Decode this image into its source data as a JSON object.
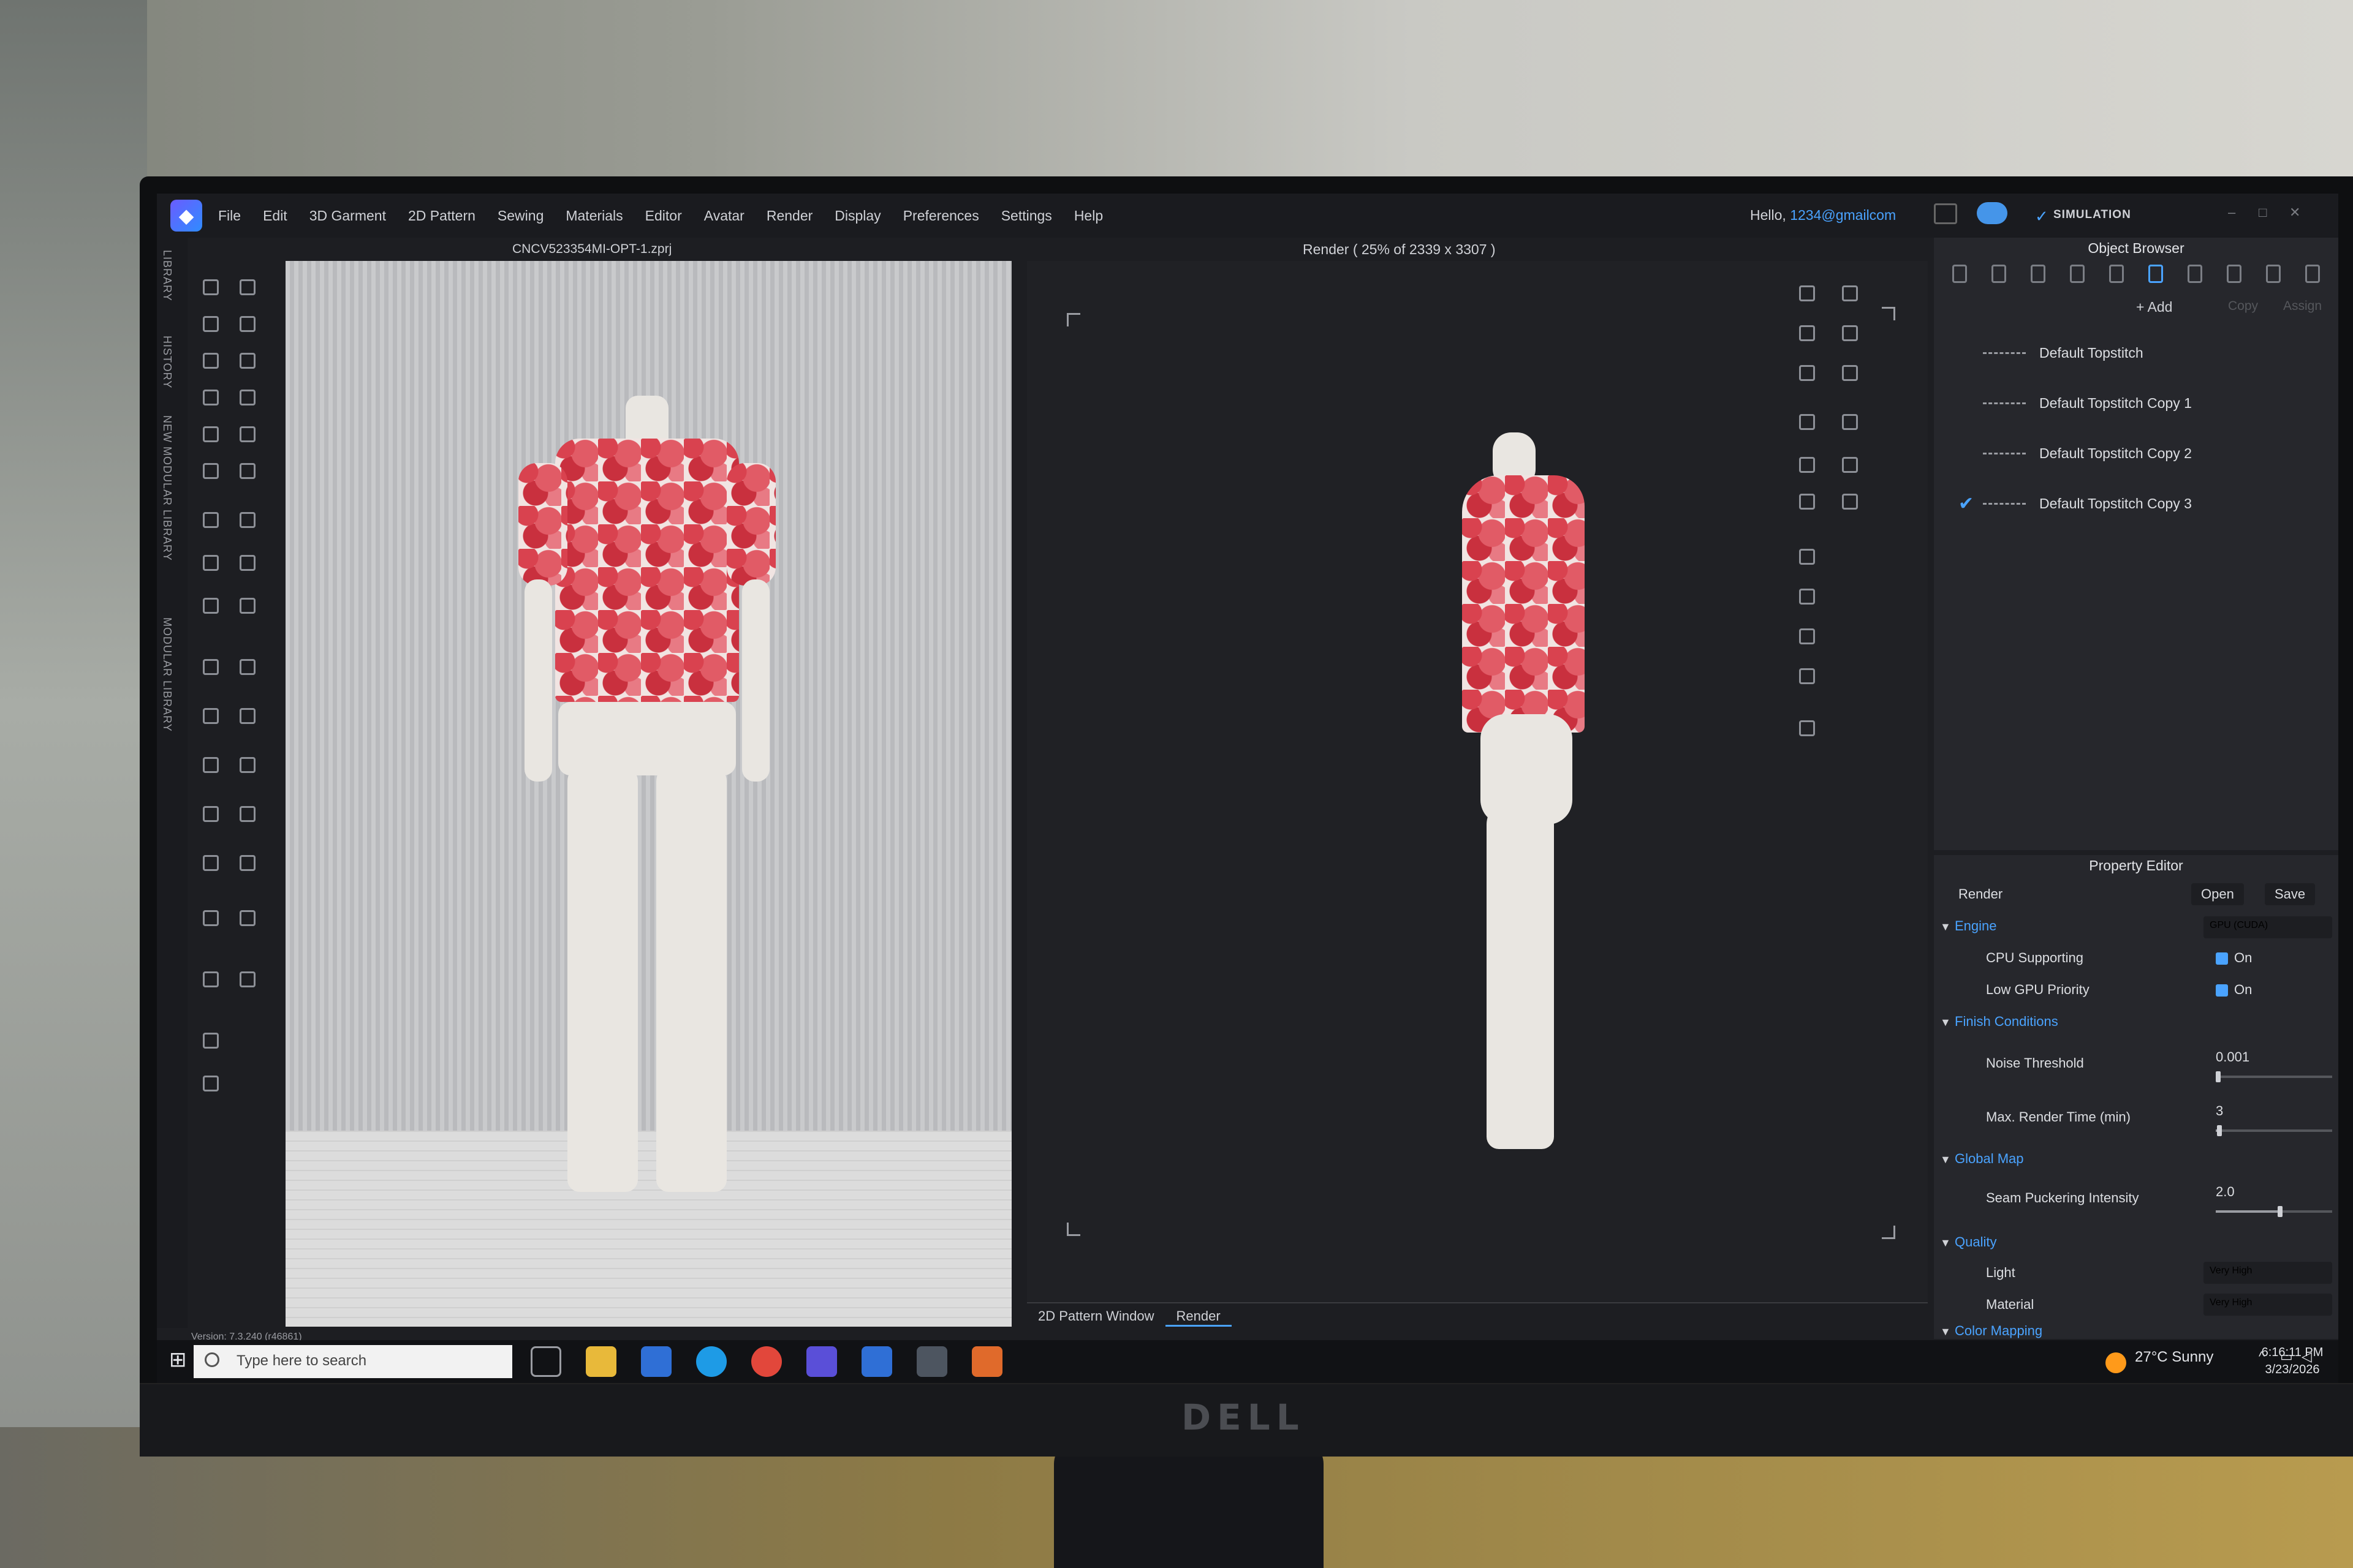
{
  "menubar": {
    "items": [
      "File",
      "Edit",
      "3D Garment",
      "2D Pattern",
      "Sewing",
      "Materials",
      "Editor",
      "Avatar",
      "Render",
      "Display",
      "Preferences",
      "Settings",
      "Help"
    ],
    "hello": "Hello,",
    "email": "1234@gmailcom",
    "simulation": "SIMULATION"
  },
  "side_tabs": [
    "LIBRARY",
    "HISTORY",
    "NEW MODULAR LIBRARY",
    "MODULAR LIBRARY"
  ],
  "viewport3d": {
    "file_title": "CNCV523354MI-OPT-1.zprj",
    "version": "Version: 7.3.240 (r46861)"
  },
  "render": {
    "title": "Render ( 25% of 2339 x 3307 )",
    "tabs": [
      "2D Pattern Window",
      "Render"
    ]
  },
  "object_browser": {
    "title": "Object Browser",
    "add": "+ Add",
    "copy": "Copy",
    "assign": "Assign",
    "items": [
      {
        "label": "Default Topstitch",
        "checked": false
      },
      {
        "label": "Default Topstitch Copy 1",
        "checked": false
      },
      {
        "label": "Default Topstitch Copy 2",
        "checked": false
      },
      {
        "label": "Default Topstitch Copy 3",
        "checked": true
      }
    ]
  },
  "property_editor": {
    "title": "Property Editor",
    "header": "Render",
    "open": "Open",
    "save": "Save",
    "engine": {
      "label": "Engine",
      "value": "GPU (CUDA)"
    },
    "cpu_supporting": {
      "label": "CPU Supporting",
      "value": "On"
    },
    "low_gpu_priority": {
      "label": "Low GPU Priority",
      "value": "On"
    },
    "finish_conditions": "Finish Conditions",
    "noise_threshold": {
      "label": "Noise Threshold",
      "value": "0.001",
      "level": 0.02
    },
    "max_render_time": {
      "label": "Max. Render Time (min)",
      "value": "3",
      "level": 0.03
    },
    "global_map": "Global Map",
    "seam_puckering": {
      "label": "Seam Puckering Intensity",
      "value": "2.0",
      "level": 0.55
    },
    "quality": "Quality",
    "light": {
      "label": "Light",
      "value": "Very High"
    },
    "material": {
      "label": "Material",
      "value": "Very High"
    },
    "color_mapping": "Color Mapping"
  },
  "taskbar": {
    "search_placeholder": "Type here to search",
    "weather": "27°C  Sunny",
    "time": "6:16:11 PM",
    "date": "3/23/2026"
  },
  "monitor_brand": "DELL",
  "colors": {
    "accent": "#4aa3ff",
    "garment_red": "#d9424f",
    "background": "#1d1e22"
  }
}
